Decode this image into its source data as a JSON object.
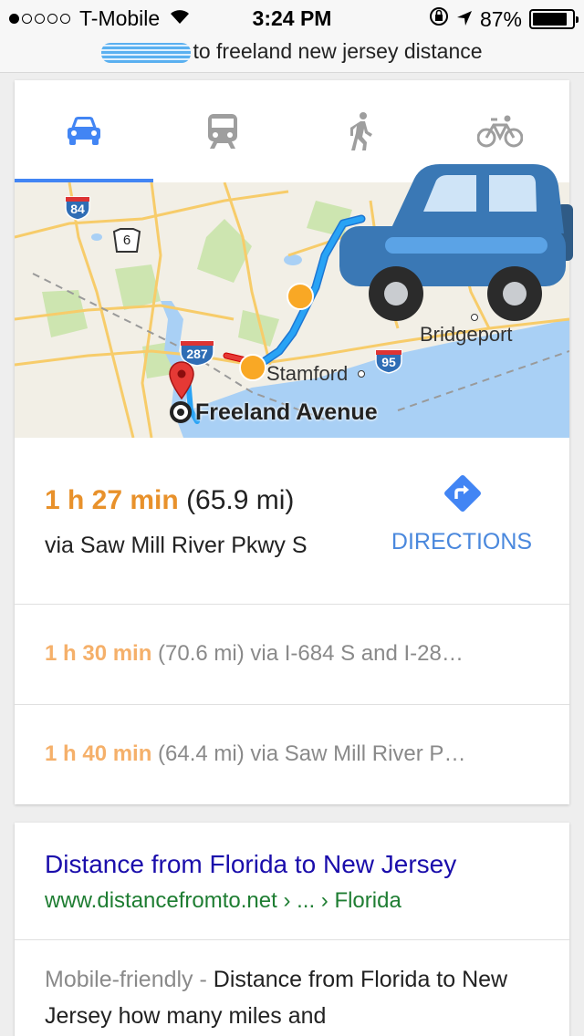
{
  "status_bar": {
    "carrier": "T-Mobile",
    "time": "3:24 PM",
    "battery": "87%",
    "battery_level": 0.87,
    "signal_bars": 1
  },
  "url_bar": {
    "query_text": "to freeland new jersey distance"
  },
  "tabs": [
    {
      "name": "drive",
      "icon": "car-icon",
      "active": true
    },
    {
      "name": "transit",
      "icon": "train-icon",
      "active": false
    },
    {
      "name": "walk",
      "icon": "walking-icon",
      "active": false
    },
    {
      "name": "bike",
      "icon": "bicycle-icon",
      "active": false
    }
  ],
  "map": {
    "labels": {
      "interstate_84": "84",
      "route_6": "6",
      "interstate_287": "287",
      "interstate_95": "95",
      "stamford": "Stamford",
      "bridgeport": "Bridgeport",
      "destination": "Freeland Avenue"
    }
  },
  "main_route": {
    "duration": "1 h 27 min",
    "distance": "(65.9 mi)",
    "via": "via Saw Mill River Pkwy S",
    "directions_label": "DIRECTIONS"
  },
  "alt_routes": [
    {
      "duration": "1 h 30 min",
      "details": " (70.6 mi) via I-684 S and I-28…"
    },
    {
      "duration": "1 h 40 min",
      "details": " (64.4 mi) via Saw Mill River P…"
    }
  ],
  "search_result": {
    "title": "Distance from Florida to New Jersey",
    "url": "www.distancefromto.net › ... › Florida",
    "mobile_friendly": "Mobile-friendly - ",
    "snippet": "Distance from Florida to New Jersey how many miles and"
  },
  "colors": {
    "accent_blue": "#4285f4",
    "duration_orange": "#e8912b",
    "route_blue": "#29a3f5",
    "link_blue": "#1a0dab",
    "url_green": "#1e7d32"
  }
}
